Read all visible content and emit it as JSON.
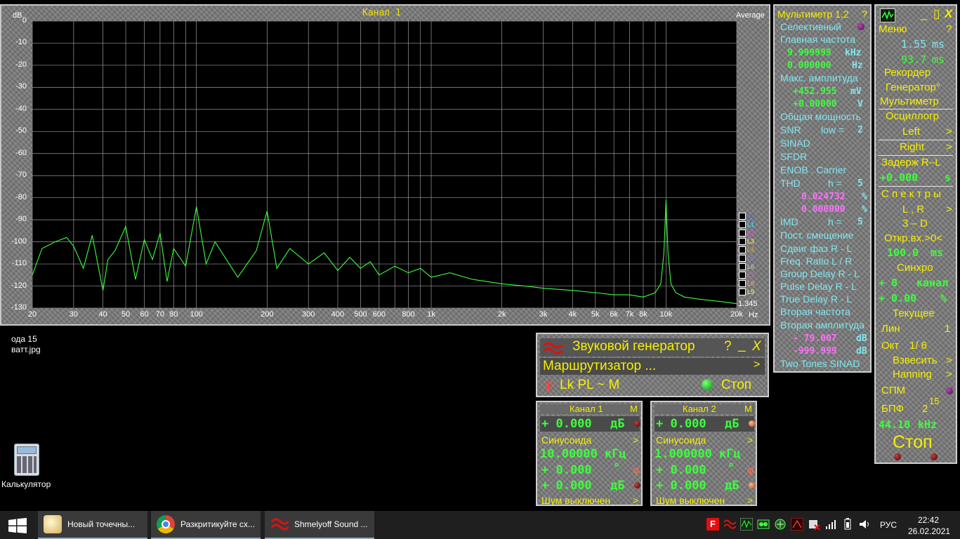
{
  "spectrum": {
    "title": "Канал 1",
    "y_unit": "dB",
    "mode": "Average",
    "x_unit": "Hz",
    "value_label": "1.345",
    "y_ticks": [
      "0",
      "-10",
      "-20",
      "-30",
      "-40",
      "-50",
      "-60",
      "-70",
      "-80",
      "-90",
      "-100",
      "-110",
      "-120",
      "-130"
    ],
    "x_ticks": [
      "20",
      "30",
      "40",
      "50",
      "60",
      "70",
      "80",
      "100",
      "200",
      "300",
      "400",
      "500",
      "600",
      "800",
      "1k",
      "2k",
      "3k",
      "4k",
      "5k",
      "6k",
      "7k",
      "8k",
      "10k",
      "20k"
    ],
    "legend": [
      "L0",
      "L1",
      "L2",
      "L3",
      "L4",
      "L5",
      "L6",
      "L7",
      "L8",
      "L9"
    ],
    "legend_colors": [
      "#4060ff",
      "#40e0ff",
      "#ff40ff",
      "#ffff40",
      "#ff9a30",
      "#8080ff",
      "#cccccc",
      "#cc66cc",
      "#ffaa66",
      "#ffff80"
    ]
  },
  "chart_data": {
    "type": "line",
    "xscale": "log",
    "xlim": [
      20,
      20000
    ],
    "ylim": [
      -130,
      0
    ],
    "ylabel": "dB",
    "xlabel": "Hz",
    "grid": true,
    "series": [
      {
        "color": "#3cff3c",
        "x": [
          20,
          22,
          25,
          28,
          30,
          33,
          36,
          40,
          42,
          45,
          50,
          55,
          60,
          65,
          70,
          75,
          80,
          90,
          100,
          110,
          120,
          150,
          180,
          200,
          220,
          250,
          300,
          350,
          400,
          450,
          500,
          550,
          600,
          700,
          800,
          900,
          1000,
          1200,
          1500,
          2000,
          2500,
          3000,
          4000,
          5000,
          6000,
          7000,
          8000,
          9000,
          9500,
          9800,
          10000,
          10200,
          10500,
          11000,
          12000,
          14000,
          17000,
          20000
        ],
        "y": [
          -115,
          -103,
          -100,
          -98,
          -102,
          -112,
          -97,
          -122,
          -108,
          -104,
          -93,
          -117,
          -99,
          -108,
          -96,
          -118,
          -103,
          -111,
          -84,
          -110,
          -100,
          -116,
          -104,
          -86,
          -112,
          -103,
          -110,
          -105,
          -113,
          -107,
          -112,
          -109,
          -115,
          -111,
          -114,
          -112,
          -116,
          -114,
          -117,
          -119,
          -120,
          -121,
          -122,
          -123,
          -124,
          -124,
          -125,
          -123,
          -119,
          -105,
          -81,
          -105,
          -119,
          -123,
          -125,
          -126,
          -127,
          -128
        ]
      }
    ]
  },
  "multimeter": {
    "title": "Мультиметр 1,2",
    "help": "?",
    "selective": "Селективный",
    "main_freq_label": "Главная частота",
    "main_freq_1": "9.999999",
    "main_freq_1_unit": "kHz",
    "main_freq_2": "0.000000",
    "main_freq_2_unit": "Hz",
    "max_amp_label": "Макс. амплитуда",
    "max_amp_1": "+452.955",
    "max_amp_1_unit": "mV",
    "max_amp_2": "+0.00000",
    "max_amp_2_unit": "V",
    "total_power": "Общая мощность",
    "snr": "SNR",
    "low": "low =",
    "low_val": "2",
    "sinad": "SINAD",
    "sfdr": "SFDR",
    "enob": "ENOB . Carrier",
    "thd": "THD",
    "h_eq": "h =",
    "thd_h": "5",
    "thd_1": "0.024732",
    "thd_2": "0.000000",
    "pct": "%",
    "imd": "IMD",
    "imd_h": "5",
    "dc_offset": "Пост. смещение",
    "phase_shift": "Сдвиг фаз R - L",
    "freq_ratio": "Freq. Ratio  L / R",
    "group_delay": "Group Delay R - L",
    "pulse_delay": "Pulse Delay R - L",
    "true_delay": "True Delay R - L",
    "second_freq": "Вторая частота",
    "second_amp": "Вторая амплитуда",
    "second_amp_1": "- 79.007",
    "second_amp_2": "-999.999",
    "db": "dB",
    "two_tones": "Two Tones SINAD"
  },
  "right_panel": {
    "menu": "Меню",
    "help": "?",
    "min": "_",
    "max": "▯",
    "close": "X",
    "time1": "1.55",
    "time2": "93.7",
    "ms": "ms",
    "recorder": "Рекордер",
    "generator": "Генератор°",
    "multimeter": "Мультиметр",
    "oscillograph": "Осциллогр",
    "left": "Left",
    "right": "Right",
    "arrow": ">",
    "delay": "Задерж  R–L",
    "delay_val": "+0.000",
    "s": "s",
    "spectra": "С п е к т р ы",
    "lr": "L , R",
    "three_d": "3 – D",
    "open_input": "Откр.вх.>0<",
    "open_val": "100.0",
    "sync": "Синхро",
    "sync_1": "+  0",
    "sync_1_unit": "канал",
    "sync_2": "+  0.00",
    "sync_2_unit": "%",
    "current": "Текущее",
    "lin": "Лин",
    "lin_val": "1",
    "okt": "Окт",
    "okt_val": "1/  6",
    "weigh": "Взвесить",
    "hanning": "Hanning",
    "spm": "СПМ",
    "fft": "БПФ",
    "fft_base": "2",
    "fft_exp": "15",
    "rate": "44.10",
    "khz": "kHz",
    "stop": "Стоп"
  },
  "generator": {
    "title": "Звуковой генератор",
    "help": "?",
    "min": "_",
    "close": "X",
    "router": "Маршрутизатор ...",
    "arrow": ">",
    "phi": "φ",
    "opts": "Lk  PL  ~  M",
    "stop": "Стоп"
  },
  "channels": [
    {
      "title": "Канал 1",
      "m": "M",
      "level": "+   0.000",
      "db": "дБ",
      "wave": "Синусоида",
      "freq": "10.00000",
      "freq_unit": "кГц",
      "phase": "+   0.000",
      "deg": "°",
      "phi": "φ",
      "level2": "+   0.000",
      "noise": "Шум выключен",
      "arrow": ">"
    },
    {
      "title": "Канал 2",
      "m": "M",
      "level": "+   0.000",
      "db": "дБ",
      "wave": "Синусоида",
      "freq": "1.000000",
      "freq_unit": "кГц",
      "phase": "+   0.000",
      "deg": "°",
      "phi": "φ",
      "level2": "+   0.000",
      "noise": "Шум выключен",
      "arrow": ">"
    }
  ],
  "desktop": {
    "file_line1": "ода 15",
    "file_line2": "ватт.jpg",
    "calc_label": "Калькулятор"
  },
  "taskbar": {
    "items": [
      "Новый точечны...",
      "Разкритикуйте сх...",
      "Shmelyoff Sound ..."
    ],
    "lang": "РУС",
    "time": "22:42",
    "date": "26.02.2021"
  }
}
